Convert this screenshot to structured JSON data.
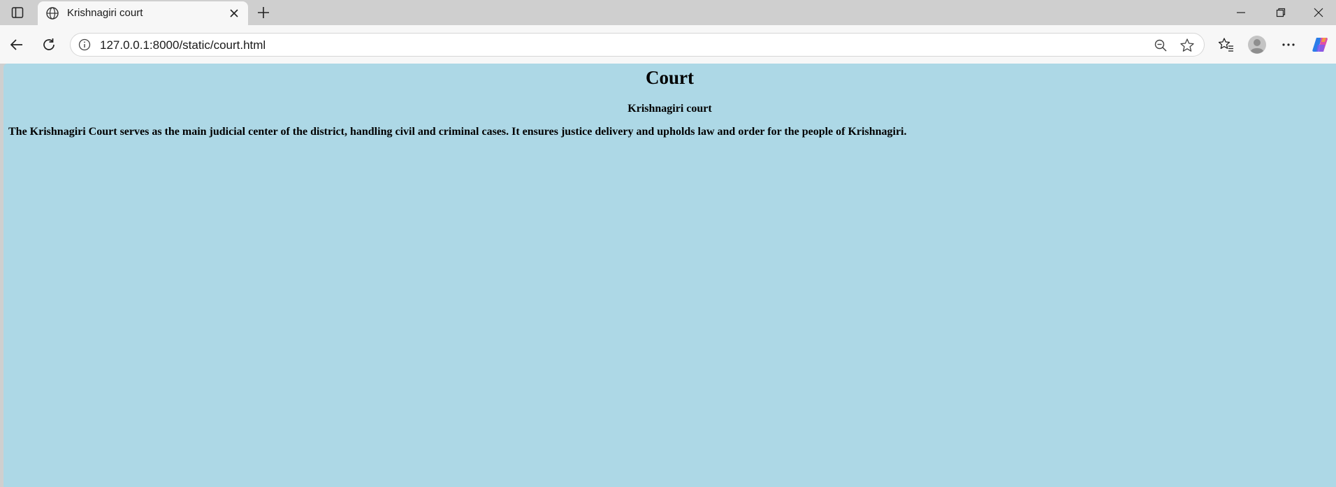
{
  "browser": {
    "tab": {
      "title": "Krishnagiri court"
    },
    "address_bar": {
      "url": "127.0.0.1:8000/static/court.html"
    },
    "icons": {
      "tab_actions": "tab-actions-icon",
      "favicon": "globe-icon",
      "tab_close": "close-icon",
      "new_tab": "plus-icon",
      "minimize": "minimize-icon",
      "restore": "restore-icon",
      "close_window": "close-icon",
      "back": "back-arrow-icon",
      "refresh": "refresh-icon",
      "site_info": "info-icon",
      "zoom": "zoom-out-icon",
      "favorite": "star-icon",
      "favorites": "favorites-icon",
      "profile": "avatar-icon",
      "more": "ellipsis-icon",
      "copilot": "copilot-icon"
    }
  },
  "page": {
    "heading": "Court",
    "subheading": "Krishnagiri court",
    "paragraph": "The Krishnagiri Court serves as the main judicial center of the district, handling civil and criminal cases. It ensures justice delivery and upholds law and order for the people of Krishnagiri.",
    "background_color": "#add8e6"
  }
}
